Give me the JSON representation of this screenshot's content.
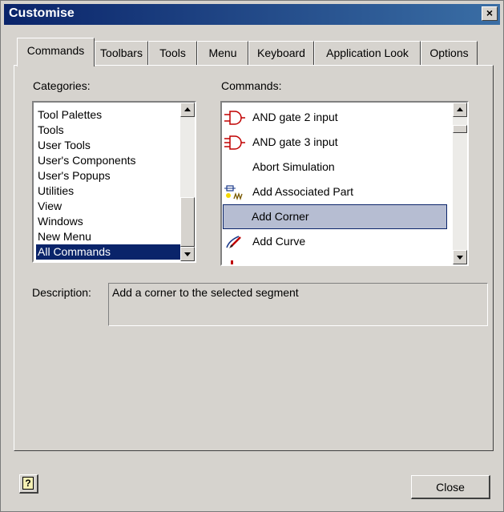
{
  "window": {
    "title": "Customise",
    "close_glyph": "×"
  },
  "tabs": [
    {
      "label": "Commands",
      "active": true
    },
    {
      "label": "Toolbars",
      "active": false
    },
    {
      "label": "Tools",
      "active": false
    },
    {
      "label": "Menu",
      "active": false
    },
    {
      "label": "Keyboard",
      "active": false
    },
    {
      "label": "Application Look",
      "active": false
    },
    {
      "label": "Options",
      "active": false
    }
  ],
  "categories": {
    "label": "Categories:",
    "items": [
      "Tool Palettes",
      "Tools",
      "User Tools",
      "User's Components",
      "User's Popups",
      "Utilities",
      "View",
      "Windows",
      "New Menu",
      "All Commands"
    ],
    "selected": "All Commands"
  },
  "commands": {
    "label": "Commands:",
    "items": [
      {
        "label": "AND gate 2 input",
        "icon": "and-gate-icon"
      },
      {
        "label": "AND gate 3 input",
        "icon": "and-gate-icon"
      },
      {
        "label": "Abort Simulation",
        "icon": ""
      },
      {
        "label": "Add Associated Part",
        "icon": "associated-part-icon"
      },
      {
        "label": "Add Corner",
        "icon": ""
      },
      {
        "label": "Add Curve",
        "icon": "curve-pen-icon"
      }
    ],
    "selected": "Add Corner"
  },
  "description": {
    "label": "Description:",
    "text": "Add a corner to the selected segment"
  },
  "footer": {
    "help_icon": "help-question-icon",
    "help_glyph": "?",
    "close_label": "Close"
  },
  "colors": {
    "title_bar": "#0a246a",
    "selection": "#0a246a",
    "command_highlight": "#b6bdd2",
    "dialog_face": "#d6d3ce"
  }
}
